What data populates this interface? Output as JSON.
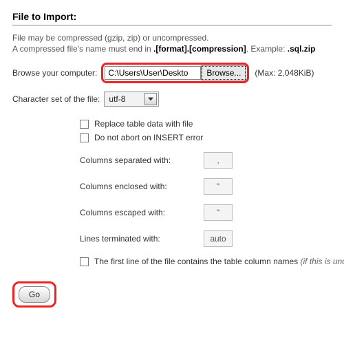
{
  "heading": "File to Import:",
  "info": {
    "line1": "File may be compressed (gzip, zip) or uncompressed.",
    "line2_pre": "A compressed file's name must end in ",
    "line2_bold": ".[format].[compression]",
    "line2_mid": ". Example: ",
    "line2_bold2": ".sql.zip"
  },
  "fileRow": {
    "label": "Browse your computer:",
    "path": "C:\\Users\\User\\Deskto",
    "browse": "Browse...",
    "max": "(Max: 2,048KiB)"
  },
  "charset": {
    "label": "Character set of the file:",
    "value": "utf-8"
  },
  "checks": {
    "replace": "Replace table data with file",
    "no_abort": "Do not abort on INSERT error"
  },
  "opts": {
    "sep": {
      "label": "Columns separated with:",
      "value": ","
    },
    "enc": {
      "label": "Columns enclosed with:",
      "value": "\""
    },
    "esc": {
      "label": "Columns escaped with:",
      "value": "\""
    },
    "term": {
      "label": "Lines terminated with:",
      "value": "auto"
    }
  },
  "firstLine": {
    "pre": "The first line of the file contains the table column names ",
    "italic": "(if this is unche"
  },
  "go": "Go"
}
